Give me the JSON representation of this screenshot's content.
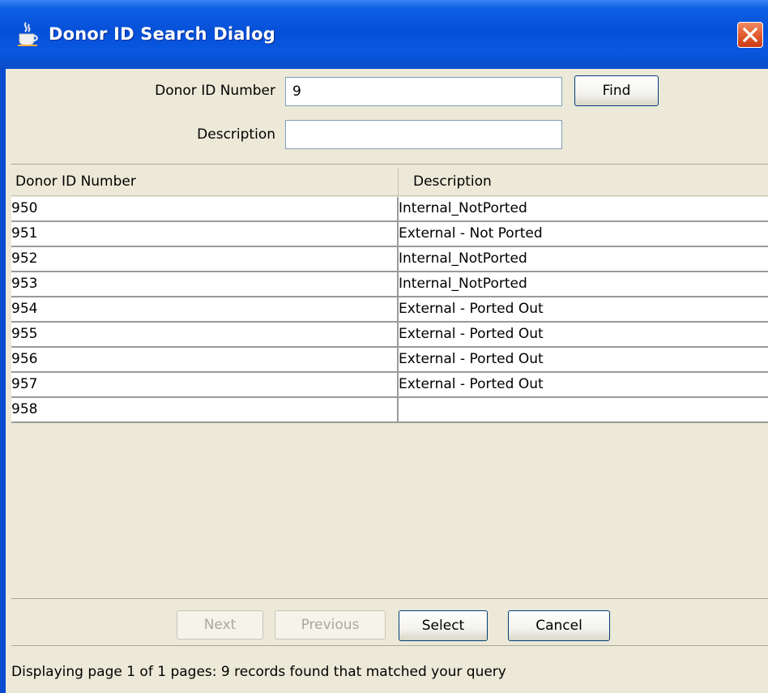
{
  "window": {
    "title": "Donor ID Search Dialog",
    "icon": "java-cup-icon",
    "accent_color": "#0a4bd0"
  },
  "form": {
    "donor_id_label": "Donor ID Number",
    "donor_id_value": "9",
    "description_label": "Description",
    "description_value": "",
    "find_label": "Find"
  },
  "table": {
    "columns": [
      "Donor ID Number",
      "Description"
    ],
    "rows": [
      [
        "950",
        "Internal_NotPorted"
      ],
      [
        "951",
        "External - Not Ported"
      ],
      [
        "952",
        "Internal_NotPorted"
      ],
      [
        "953",
        "Internal_NotPorted"
      ],
      [
        "954",
        "External - Ported Out"
      ],
      [
        "955",
        "External - Ported Out"
      ],
      [
        "956",
        "External - Ported Out"
      ],
      [
        "957",
        "External - Ported Out"
      ],
      [
        "958",
        ""
      ]
    ]
  },
  "buttons": {
    "next": "Next",
    "previous": "Previous",
    "select": "Select",
    "cancel": "Cancel"
  },
  "status": {
    "text": "Displaying page 1 of 1 pages:   9 records found that matched your query"
  }
}
